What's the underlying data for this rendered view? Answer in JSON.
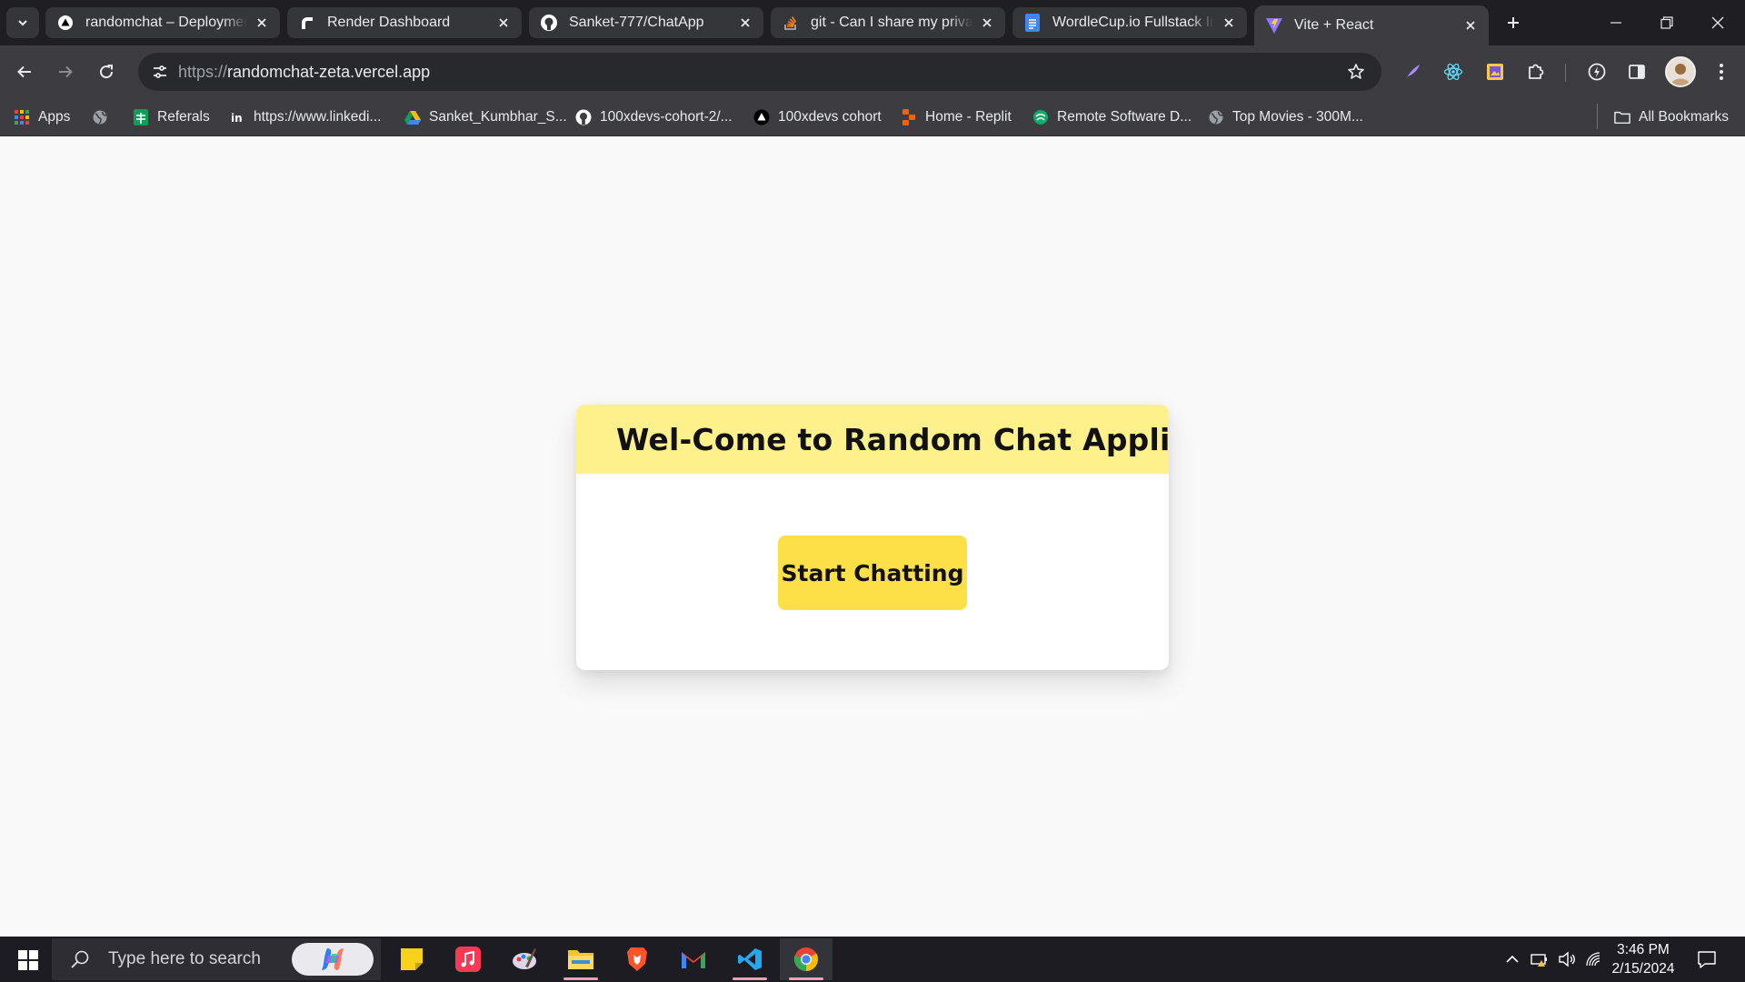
{
  "browser": {
    "tabs": [
      {
        "title": "randomchat – Deployment",
        "favicon": "vercel-icon",
        "active": false
      },
      {
        "title": "Render Dashboard",
        "favicon": "render-icon",
        "active": false
      },
      {
        "title": "Sanket-777/ChatApp",
        "favicon": "github-icon",
        "active": false
      },
      {
        "title": "git - Can I share my private",
        "favicon": "stackoverflow-icon",
        "active": false
      },
      {
        "title": "WordleCup.io Fullstack Inte",
        "favicon": "google-docs-icon",
        "active": false
      },
      {
        "title": "Vite + React",
        "favicon": "vite-icon",
        "active": true
      }
    ],
    "url": {
      "scheme": "https://",
      "host": "randomchat-zeta.vercel.app"
    },
    "bookmarks": [
      {
        "label": "Apps",
        "icon": "apps-grid-icon"
      },
      {
        "label": "",
        "icon": "globe-icon"
      },
      {
        "label": "Referals",
        "icon": "google-sheets-icon"
      },
      {
        "label": "https://www.linkedi...",
        "icon": "linkedin-icon"
      },
      {
        "label": "Sanket_Kumbhar_S...",
        "icon": "google-drive-icon"
      },
      {
        "label": "100xdevs-cohort-2/...",
        "icon": "github-icon"
      },
      {
        "label": "100xdevs cohort",
        "icon": "vercel-icon"
      },
      {
        "label": "Home - Replit",
        "icon": "replit-icon"
      },
      {
        "label": "Remote Software D...",
        "icon": "remote-icon"
      },
      {
        "label": "Top Movies - 300M...",
        "icon": "globe-icon"
      }
    ],
    "all_bookmarks": "All Bookmarks"
  },
  "page": {
    "title": "Wel-Come to Random Chat Application",
    "start_button": "Start Chatting"
  },
  "taskbar": {
    "search_placeholder": "Type here to search",
    "time": "3:46 PM",
    "date": "2/15/2024"
  }
}
